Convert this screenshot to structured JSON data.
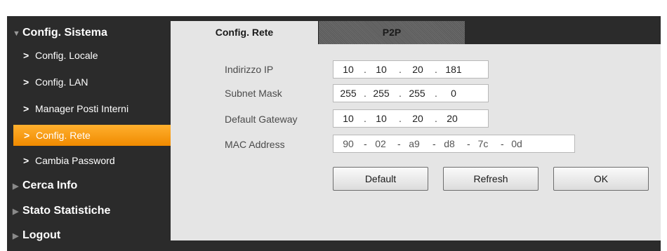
{
  "sidebar": {
    "categories": {
      "config_sistema": "Config. Sistema",
      "cerca_info": "Cerca Info",
      "stato_statistiche": "Stato Statistiche",
      "logout": "Logout"
    },
    "items": [
      {
        "label": "Config. Locale"
      },
      {
        "label": "Config. LAN"
      },
      {
        "label": "Manager Posti Interni"
      },
      {
        "label": "Config. Rete",
        "active": true
      },
      {
        "label": "Cambia Password"
      }
    ]
  },
  "tabs": {
    "config_rete": "Config. Rete",
    "p2p": "P2P"
  },
  "form": {
    "ip_label": "Indirizzo IP",
    "ip": [
      "10",
      "10",
      "20",
      "181"
    ],
    "subnet_label": "Subnet Mask",
    "subnet": [
      "255",
      "255",
      "255",
      "0"
    ],
    "gateway_label": "Default Gateway",
    "gateway": [
      "10",
      "10",
      "20",
      "20"
    ],
    "mac_label": "MAC Address",
    "mac": [
      "90",
      "02",
      "a9",
      "d8",
      "7c",
      "0d"
    ],
    "ip_separator": ".",
    "mac_separator": "-"
  },
  "buttons": {
    "default": "Default",
    "refresh": "Refresh",
    "ok": "OK"
  },
  "colors": {
    "accent": "#f39a10",
    "sidebar_bg": "#2b2b2b",
    "panel_bg": "#e5e5e5"
  }
}
